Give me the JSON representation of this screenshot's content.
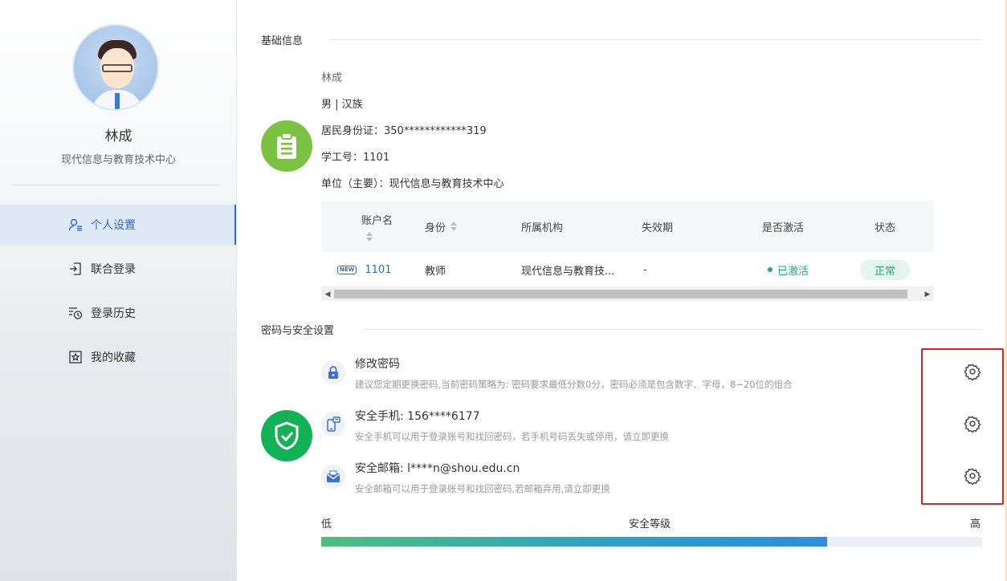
{
  "sidebar": {
    "user_name": "林成",
    "user_dept": "现代信息与教育技术中心",
    "nav": [
      {
        "label": "个人设置",
        "icon": "user-settings-icon",
        "active": true
      },
      {
        "label": "联合登录",
        "icon": "login-icon",
        "active": false
      },
      {
        "label": "登录历史",
        "icon": "history-icon",
        "active": false
      },
      {
        "label": "我的收藏",
        "icon": "star-icon",
        "active": false
      }
    ]
  },
  "basic_info": {
    "section_title": "基础信息",
    "name": "林成",
    "gender_ethnicity": "男 | 汉族",
    "id_card": "居民身份证：350************319",
    "staff_no": "学工号：1101",
    "unit": "单位（主要）：现代信息与教育技术中心"
  },
  "accounts_table": {
    "headers": [
      "账户名",
      "身份",
      "所属机构",
      "失效期",
      "是否激活",
      "状态"
    ],
    "rows": [
      {
        "badge": "NEW",
        "account": "1101",
        "identity": "教师",
        "org": "现代信息与教育技...",
        "expiry": "-",
        "activated": "已激活",
        "status": "正常"
      }
    ],
    "scroll_left": "◀",
    "scroll_right": "▶"
  },
  "security": {
    "section_title": "密码与安全设置",
    "items": [
      {
        "title": "修改密码",
        "desc": "建议您定期更换密码,当前密码策略为: 密码要求最低分数0分，密码必须是包含数字、字母，8~20位的组合",
        "icon": "lock-icon"
      },
      {
        "title": "安全手机: 156****6177",
        "desc": "安全手机可以用于登录账号和找回密码，若手机号码丢失或停用，请立即更换",
        "icon": "phone-icon"
      },
      {
        "title": "安全邮箱: l****n@shou.edu.cn",
        "desc": "安全邮箱可以用于登录账号和找回密码,若邮箱弃用,请立即更换",
        "icon": "mail-icon"
      }
    ],
    "level": {
      "low": "低",
      "label": "安全等级",
      "high": "高",
      "fraction": 0.765
    }
  },
  "colors": {
    "accent": "#2a6bd1",
    "info_icon_bg": "#7cc242",
    "shield_icon_bg": "#14b256",
    "active_green": "#1fa87a",
    "highlight_red": "#e02020"
  }
}
